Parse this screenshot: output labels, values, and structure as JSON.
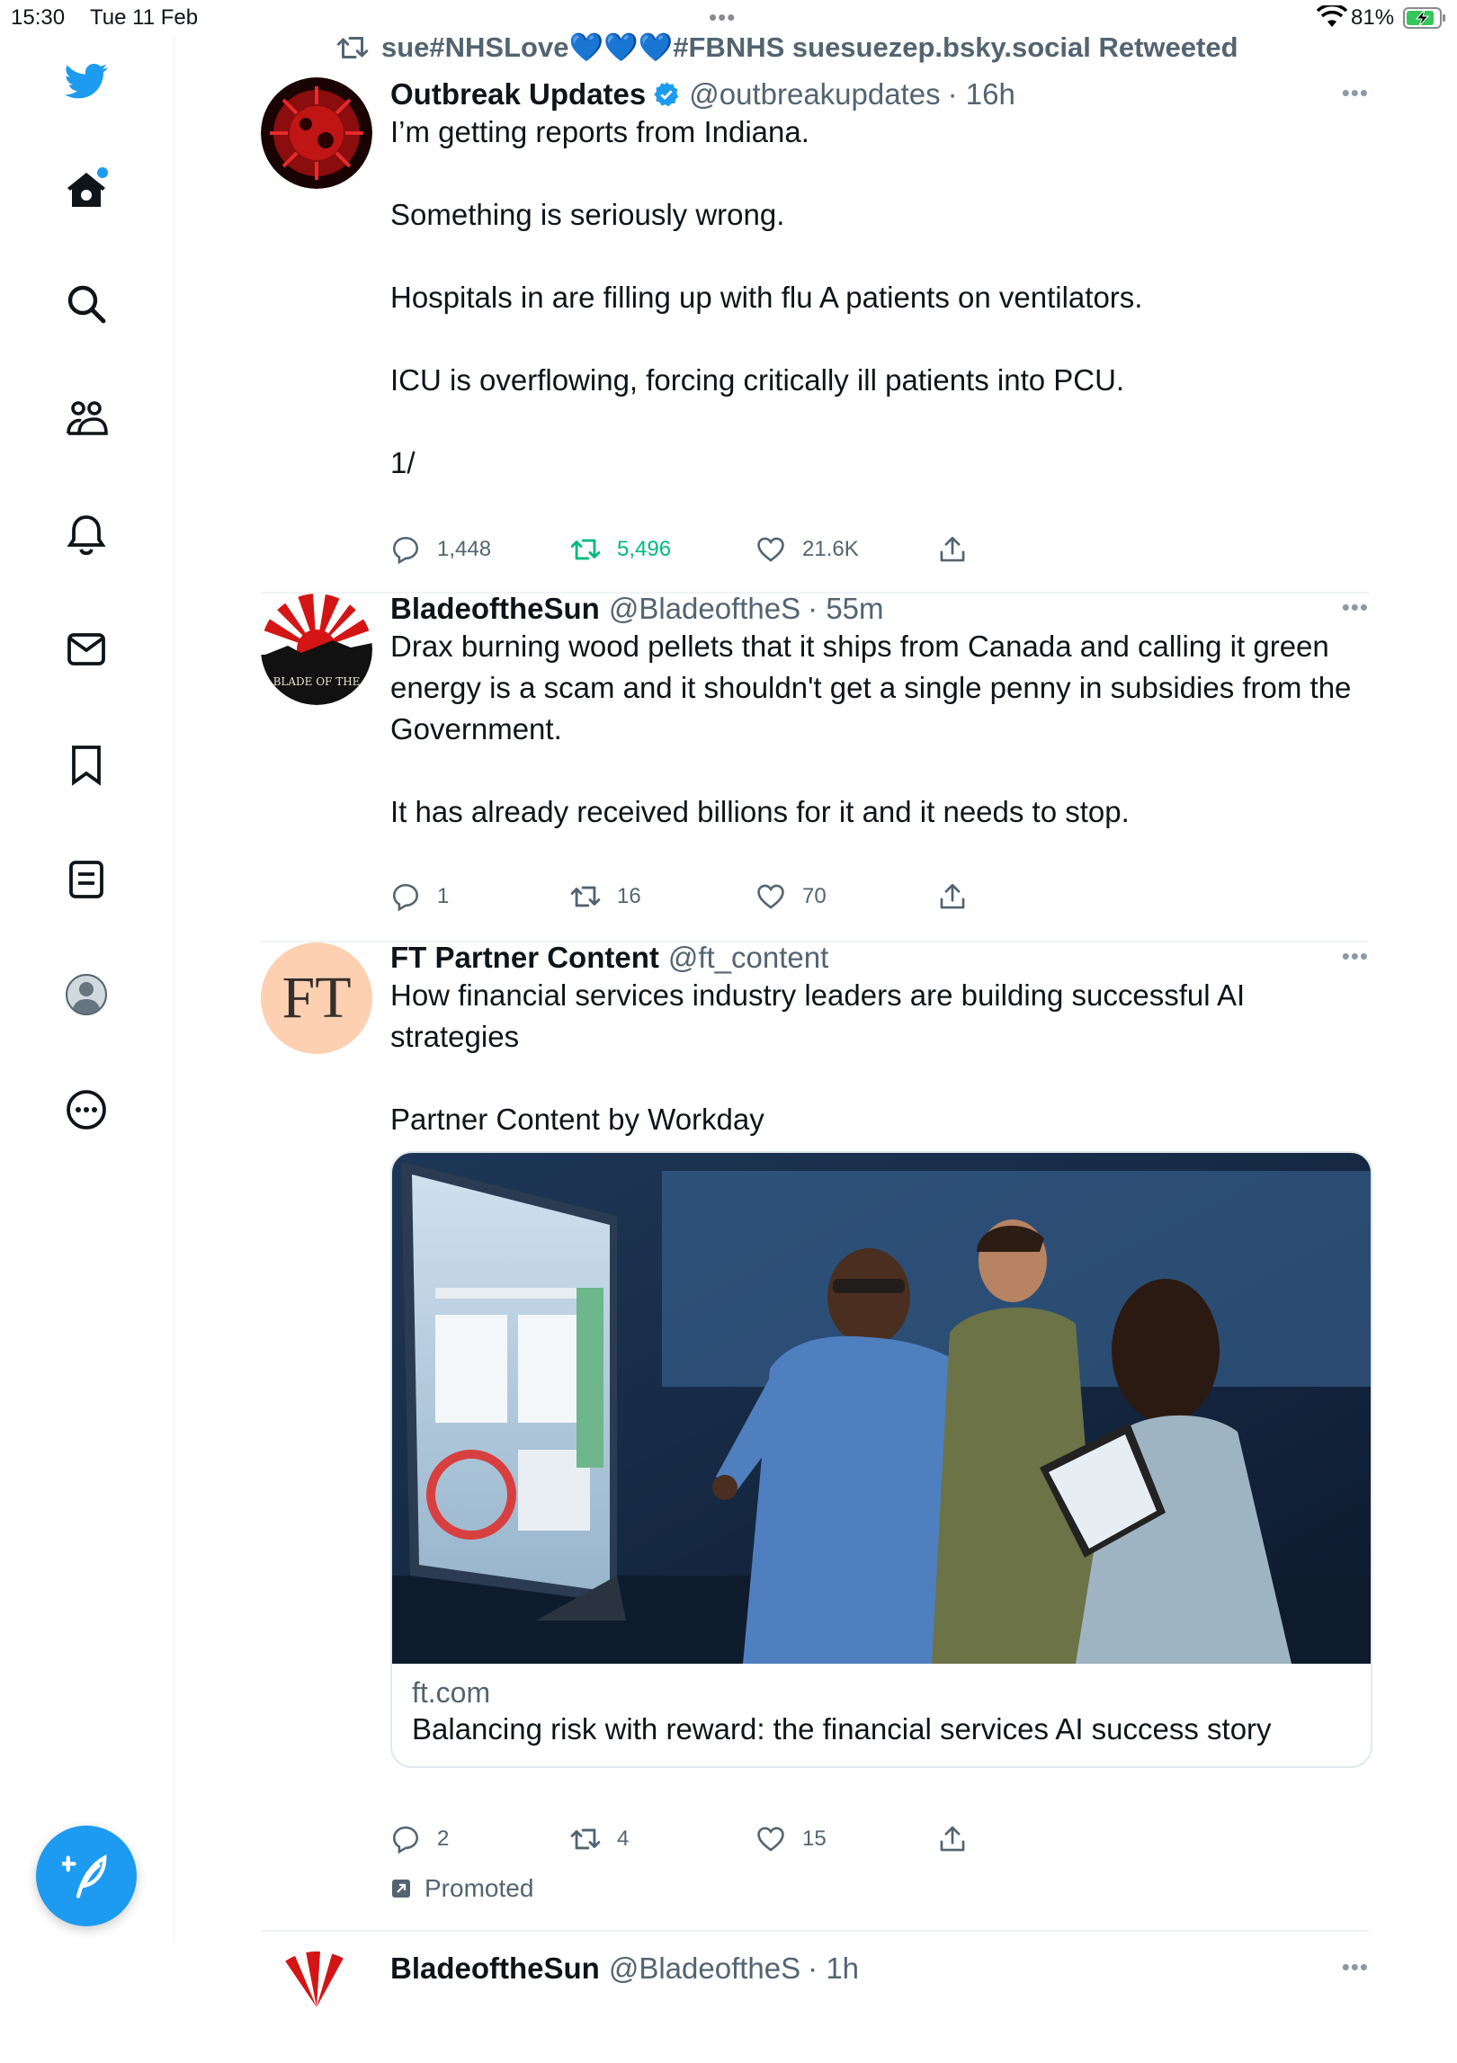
{
  "status_bar": {
    "time": "15:30",
    "date": "Tue 11 Feb",
    "battery": "81%"
  },
  "sidebar": {
    "items": [
      {
        "icon": "twitter-bird-logo-icon"
      },
      {
        "icon": "home-icon"
      },
      {
        "icon": "search-icon"
      },
      {
        "icon": "communities-icon"
      },
      {
        "icon": "notifications-bell-icon"
      },
      {
        "icon": "messages-envelope-icon"
      },
      {
        "icon": "bookmark-icon"
      },
      {
        "icon": "lists-icon"
      },
      {
        "icon": "profile-avatar-icon"
      },
      {
        "icon": "more-circle-icon"
      }
    ],
    "compose_icon": "compose-feather-icon"
  },
  "feed": {
    "retweet_context": "sue#NHSLove💙💙💙#FBNHS suesuezep.bsky.social Retweeted",
    "tweets": [
      {
        "name": "Outbreak Updates",
        "verified": true,
        "handle": "@outbreakupdates",
        "time": "· 16h",
        "text": "I’m getting reports from Indiana.\n\nSomething is seriously wrong.\n\nHospitals in are filling up with flu A patients on ventilators.\n\nICU is overflowing, forcing critically ill patients into PCU.\n\n1/",
        "replies": "1,448",
        "retweets": "5,496",
        "likes": "21.6K"
      },
      {
        "name": "BladeoftheSun",
        "handle": "@BladeoftheS",
        "time": "· 55m",
        "avatar_text": "BLADE OF THE",
        "text": "Drax burning wood pellets that it ships from Canada and calling it green energy is a scam and it shouldn't get a single penny in subsidies from the Government.\n\nIt has already received billions for it and it needs to stop.",
        "replies": "1",
        "retweets": "16",
        "likes": "70"
      },
      {
        "name": "FT Partner Content",
        "handle": "@ft_content",
        "avatar_text": "FT",
        "text": "How financial services industry leaders are building successful AI strategies\n\nPartner Content by Workday",
        "card": {
          "domain": "ft.com",
          "title": "Balancing risk with reward: the financial services AI success story"
        },
        "replies": "2",
        "retweets": "4",
        "likes": "15",
        "promoted": "Promoted"
      },
      {
        "name": "BladeoftheSun",
        "handle": "@BladeoftheS",
        "time": "· 1h"
      }
    ]
  },
  "colors": {
    "accent": "#1d9bf0",
    "retweet_green": "#00ba7c",
    "secondary_text": "#536471"
  }
}
